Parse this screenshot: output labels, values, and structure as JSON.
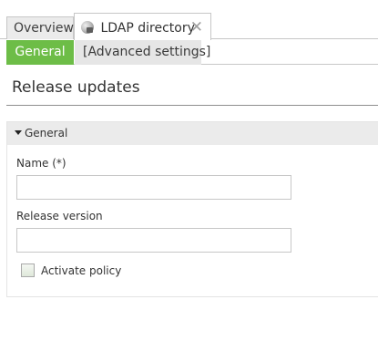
{
  "tabs": [
    {
      "label": "Overview"
    },
    {
      "label": "LDAP directory",
      "icon": "ldap-directory-icon",
      "close": "✕"
    }
  ],
  "subtabs": {
    "general": "General",
    "advanced": "[Advanced settings]"
  },
  "page": {
    "title": "Release updates"
  },
  "section": {
    "title": "General",
    "fields": {
      "name_label": "Name (*)",
      "name_value": "",
      "release_label": "Release version",
      "release_value": ""
    },
    "activate_policy_label": "Activate policy",
    "activate_policy_checked": false
  },
  "colors": {
    "active_subtab": "#6dbd47",
    "header_bg": "#ebebeb"
  }
}
